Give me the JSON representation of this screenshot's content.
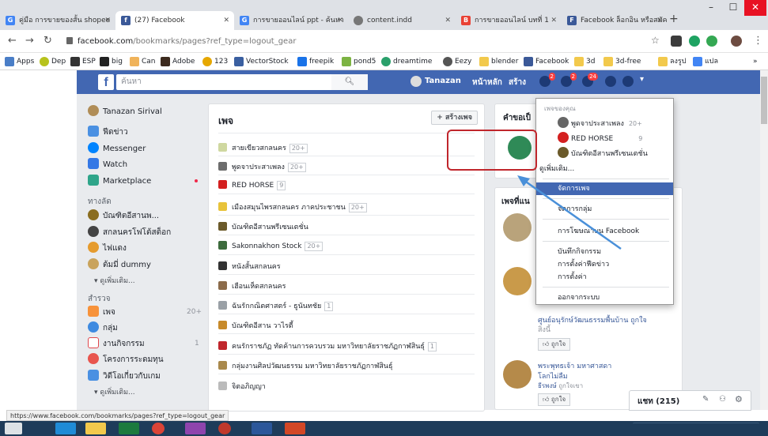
{
  "browser": {
    "tabs": [
      {
        "label": "คู่มือ การขายของสั้น shopee"
      },
      {
        "label": "(27) Facebook"
      },
      {
        "label": "การขายออนไลน์ ppt - ค้นหา"
      },
      {
        "label": "content.indd"
      },
      {
        "label": "การขายออนไลน์ บทที่ 1"
      },
      {
        "label": "Facebook ล็อกอิน หรือสมัคร"
      }
    ],
    "url_host": "facebook.com",
    "url_path": "/bookmarks/pages?ref_type=logout_gear",
    "bookmarks": [
      "Apps",
      "Dep",
      "ESP",
      "big",
      "Can",
      "Adobe",
      "123",
      "VectorStock",
      "freepik",
      "pond5",
      "dreamtime",
      "Eezy",
      "blender",
      "Facebook",
      "3d",
      "3d-free",
      "ลงรูป",
      "แปล"
    ],
    "status_url": "https://www.facebook.com/bookmarks/pages?ref_type=logout_gear"
  },
  "fbbar": {
    "search_placeholder": "ค้นหา",
    "user": "Tanazan",
    "home": "หน้าหลัก",
    "create": "สร้าง",
    "badges": [
      "2",
      "2",
      "24"
    ]
  },
  "left_nav": {
    "profile": "Tanazan Sirival",
    "items": [
      "ฟีดข่าว",
      "Messenger",
      "Watch",
      "Marketplace"
    ],
    "shortcuts_title": "ทางลัด",
    "shortcuts": [
      "บัณฑิตอีสานพ...",
      "สกลนครโฟโต้สต็อก",
      "ไฟแดง",
      "ต้มมี่ dummy"
    ],
    "see_more_1": "ดูเพิ่มเติม...",
    "explore_title": "สำรวจ",
    "explore": [
      {
        "label": "เพจ",
        "count": "20+"
      },
      {
        "label": "กลุ่ม",
        "count": ""
      },
      {
        "label": "งานกิจกรรม",
        "count": "1"
      },
      {
        "label": "โครงการระดมทุน",
        "count": ""
      },
      {
        "label": "วิดีโอเกี่ยวกับเกม",
        "count": ""
      }
    ],
    "see_more_2": "ดูเพิ่มเติม..."
  },
  "pages_panel": {
    "title": "เพจ",
    "create_button": "+ สร้างเพจ",
    "rows": [
      {
        "name": "สายเขียวสกลนคร",
        "count": "20+"
      },
      {
        "name": "พูดจาประสาเพลง",
        "count": "20+"
      },
      {
        "name": "RED HORSE",
        "count": "9"
      },
      {
        "name": "เมืองสมุนไพรสกลนคร ภาคประชาชน",
        "count": "20+"
      },
      {
        "name": "บัณฑิตอีสานพรีเซนเตชั่น",
        "count": ""
      },
      {
        "name": "Sakonnakhon Stock",
        "count": "20+"
      },
      {
        "name": "หนังสั้นสกลนคร",
        "count": ""
      },
      {
        "name": "เฮือนเห็ดสกลนคร",
        "count": ""
      },
      {
        "name": "ฉันรักกณิตศาสตร์ - ธูนันทชัย",
        "count": "1"
      },
      {
        "name": "บัณฑิตอีสาน วาไรตี้",
        "count": ""
      },
      {
        "name": "คนรักราชภัฏ ทัดค้านการควบรวม มหาวิทยาลัยราชภัฏกาฬสินธุ์",
        "count": "1"
      },
      {
        "name": "กลุ่มงานศิลปวัฒนธรรม มหาวิทยาลัยราชภัฏกาฬสินธุ์",
        "count": ""
      },
      {
        "name": "จิตอภิญญา",
        "count": ""
      }
    ]
  },
  "right_col": {
    "invites_title": "คำขอเป็",
    "suggest_title": "เพจที่แน",
    "suggest_text": "ศูนย์อนุรักษ์วัฒนธรรมพื้นบ้าน ถูกใจ",
    "suggest_line2": "สิ่งนี้",
    "like_label": "ถูกใจ",
    "page2_name_1": "พระพุทธเจ้า มหาศาสดา",
    "page2_name_2": "โลกไม่ลืม",
    "page2_liker": "ธีรพงษ์",
    "page2_liked": "ถูกใจเขา",
    "like_label_2": "ถูกใจ"
  },
  "dropdown": {
    "your_pages": "เพจของคุณ",
    "pages": [
      {
        "name": "พูดจาประสาเพลง",
        "count": "20+"
      },
      {
        "name": "RED HORSE",
        "count": "9"
      },
      {
        "name": "บัณฑิตอีสานพรีเซนเตชั่น",
        "count": ""
      }
    ],
    "see_more": "ดูเพิ่มเติม...",
    "manage_pages": "จัดการเพจ",
    "manage_groups": "จัดการกลุ่ม",
    "advertise": "การโฆษณาบน Facebook",
    "activity_log": "บันทึกกิจกรรม",
    "news_feed_prefs": "การตั้งค่าฟีดข่าว",
    "settings": "การตั้งค่า",
    "logout": "ออกจากระบบ"
  },
  "chat": {
    "label": "แชท (215)"
  }
}
